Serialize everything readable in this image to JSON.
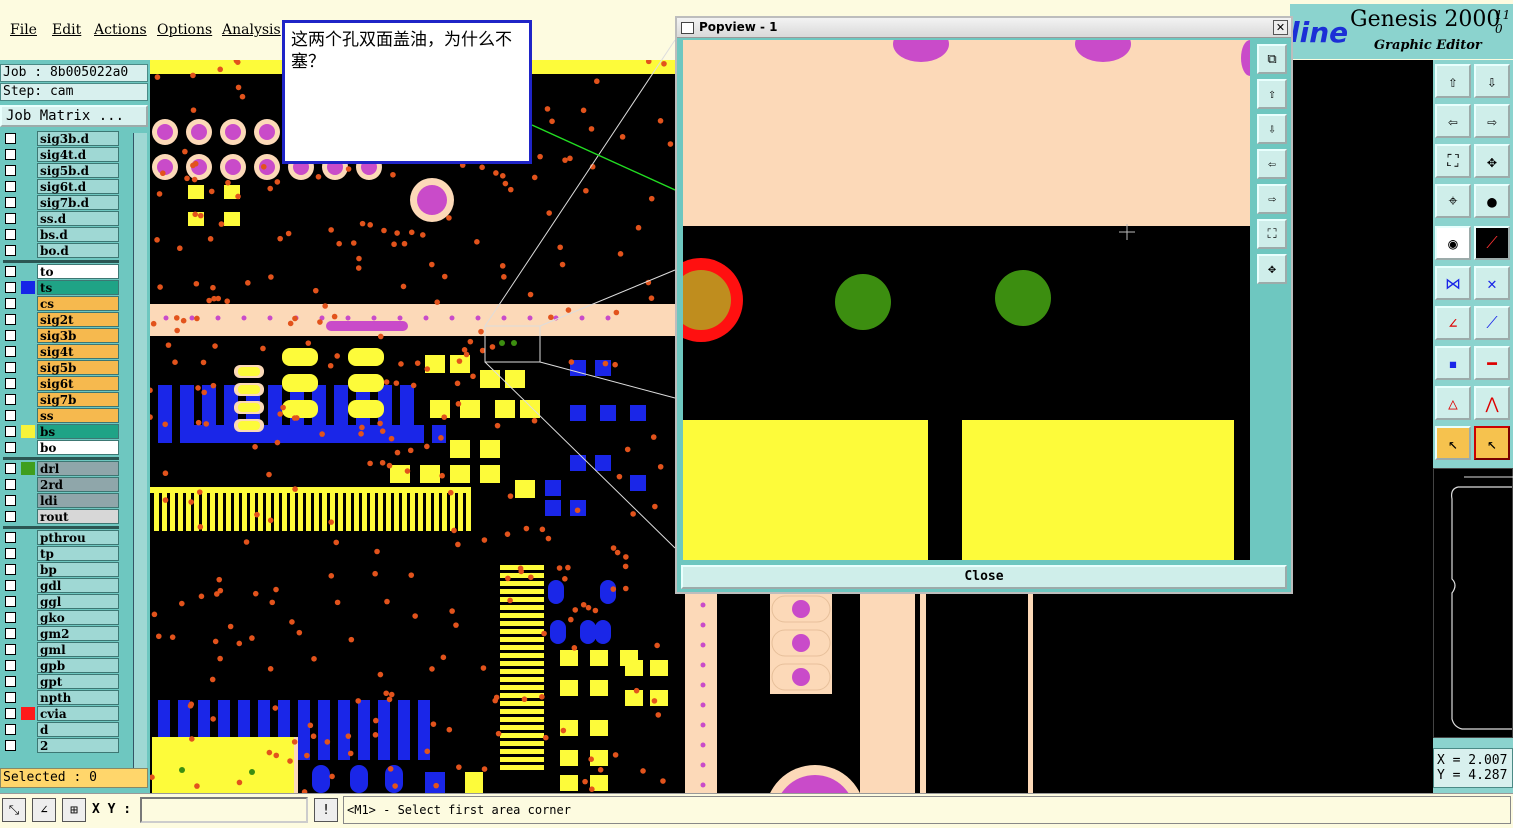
{
  "menubar": {
    "items": [
      "File",
      "Edit",
      "Actions",
      "Options",
      "Analysis"
    ]
  },
  "left": {
    "job_line": "Job : 8b005022a0",
    "step_line": "Step: cam",
    "job_matrix": "Job Matrix ...",
    "selected": "Selected : 0",
    "layers": [
      {
        "name": "sig3b.d",
        "color": "#9fd8d4",
        "swatch": ""
      },
      {
        "name": "sig4t.d",
        "color": "#9fd8d4",
        "swatch": ""
      },
      {
        "name": "sig5b.d",
        "color": "#9fd8d4",
        "swatch": ""
      },
      {
        "name": "sig6t.d",
        "color": "#9fd8d4",
        "swatch": ""
      },
      {
        "name": "sig7b.d",
        "color": "#9fd8d4",
        "swatch": ""
      },
      {
        "name": "ss.d",
        "color": "#9fd8d4",
        "swatch": ""
      },
      {
        "name": "bs.d",
        "color": "#9fd8d4",
        "swatch": ""
      },
      {
        "name": "bo.d",
        "color": "#9fd8d4",
        "swatch": ""
      },
      {
        "name": "to",
        "color": "#ffffff",
        "swatch": ""
      },
      {
        "name": "ts",
        "color": "#1fa386",
        "swatch": "#1625e8"
      },
      {
        "name": "cs",
        "color": "#f6b94e",
        "swatch": ""
      },
      {
        "name": "sig2t",
        "color": "#f6b94e",
        "swatch": ""
      },
      {
        "name": "sig3b",
        "color": "#f6b94e",
        "swatch": ""
      },
      {
        "name": "sig4t",
        "color": "#f6b94e",
        "swatch": ""
      },
      {
        "name": "sig5b",
        "color": "#f6b94e",
        "swatch": ""
      },
      {
        "name": "sig6t",
        "color": "#f6b94e",
        "swatch": ""
      },
      {
        "name": "sig7b",
        "color": "#f6b94e",
        "swatch": ""
      },
      {
        "name": "ss",
        "color": "#f6b94e",
        "swatch": ""
      },
      {
        "name": "bs",
        "color": "#1fa386",
        "swatch": "#f7f33a"
      },
      {
        "name": "bo",
        "color": "#ffffff",
        "swatch": ""
      },
      {
        "name": "drl",
        "color": "#8fa6aa",
        "swatch": "#3f9e1d"
      },
      {
        "name": "2rd",
        "color": "#8fa6aa",
        "swatch": ""
      },
      {
        "name": "ldi",
        "color": "#8fa6aa",
        "swatch": ""
      },
      {
        "name": "rout",
        "color": "#d7d7d7",
        "swatch": ""
      },
      {
        "name": "pthrou",
        "color": "#9fd8d4",
        "swatch": ""
      },
      {
        "name": "tp",
        "color": "#9fd8d4",
        "swatch": ""
      },
      {
        "name": "bp",
        "color": "#9fd8d4",
        "swatch": ""
      },
      {
        "name": "gdl",
        "color": "#9fd8d4",
        "swatch": ""
      },
      {
        "name": "ggl",
        "color": "#9fd8d4",
        "swatch": ""
      },
      {
        "name": "gko",
        "color": "#9fd8d4",
        "swatch": ""
      },
      {
        "name": "gm2",
        "color": "#9fd8d4",
        "swatch": ""
      },
      {
        "name": "gml",
        "color": "#9fd8d4",
        "swatch": ""
      },
      {
        "name": "gpb",
        "color": "#9fd8d4",
        "swatch": ""
      },
      {
        "name": "gpt",
        "color": "#9fd8d4",
        "swatch": ""
      },
      {
        "name": "npth",
        "color": "#9fd8d4",
        "swatch": ""
      },
      {
        "name": "cvia",
        "color": "#9fd8d4",
        "swatch": "#ff1a1a"
      },
      {
        "name": "d",
        "color": "#9fd8d4",
        "swatch": ""
      },
      {
        "name": "2",
        "color": "#9fd8d4",
        "swatch": ""
      }
    ]
  },
  "note": {
    "text": "这两个孔双面盖油，为什么不塞？"
  },
  "popview": {
    "title": "Popview - 1",
    "close_x": "✕",
    "close_label": "Close"
  },
  "brand": {
    "logo": "line",
    "title": "Genesis 2000",
    "subtitle": "Graphic Editor",
    "version": "11 0"
  },
  "coords": {
    "x": "X = 2.007",
    "y": "Y = 4.287"
  },
  "status": {
    "xy_label": "X Y :",
    "xy_value": "",
    "message": "<M1> - Select first area corner"
  },
  "colors": {
    "pad_yellow": "#fdfb3a",
    "pad_blue": "#1a26e8",
    "via_orange": "#e2531c",
    "mask_peach": "#fcd9b8",
    "pad_magenta": "#c94bc9",
    "drill_green": "#3c8e10",
    "popview_bg": "#fcd9b8"
  },
  "icons": {
    "toolbar": [
      "zoom-in-icon",
      "zoom-out-icon",
      "pan-left-icon",
      "pan-right-icon",
      "fit-icon",
      "center-icon",
      "measure-icon",
      "snap-icon",
      "select-icon",
      "draw-icon",
      "net-icon",
      "cross-icon",
      "line-icon",
      "line2-icon",
      "pad-icon",
      "bar-icon",
      "triangle-icon",
      "triangle2-icon",
      "pointer-icon",
      "pointer2-icon"
    ]
  }
}
